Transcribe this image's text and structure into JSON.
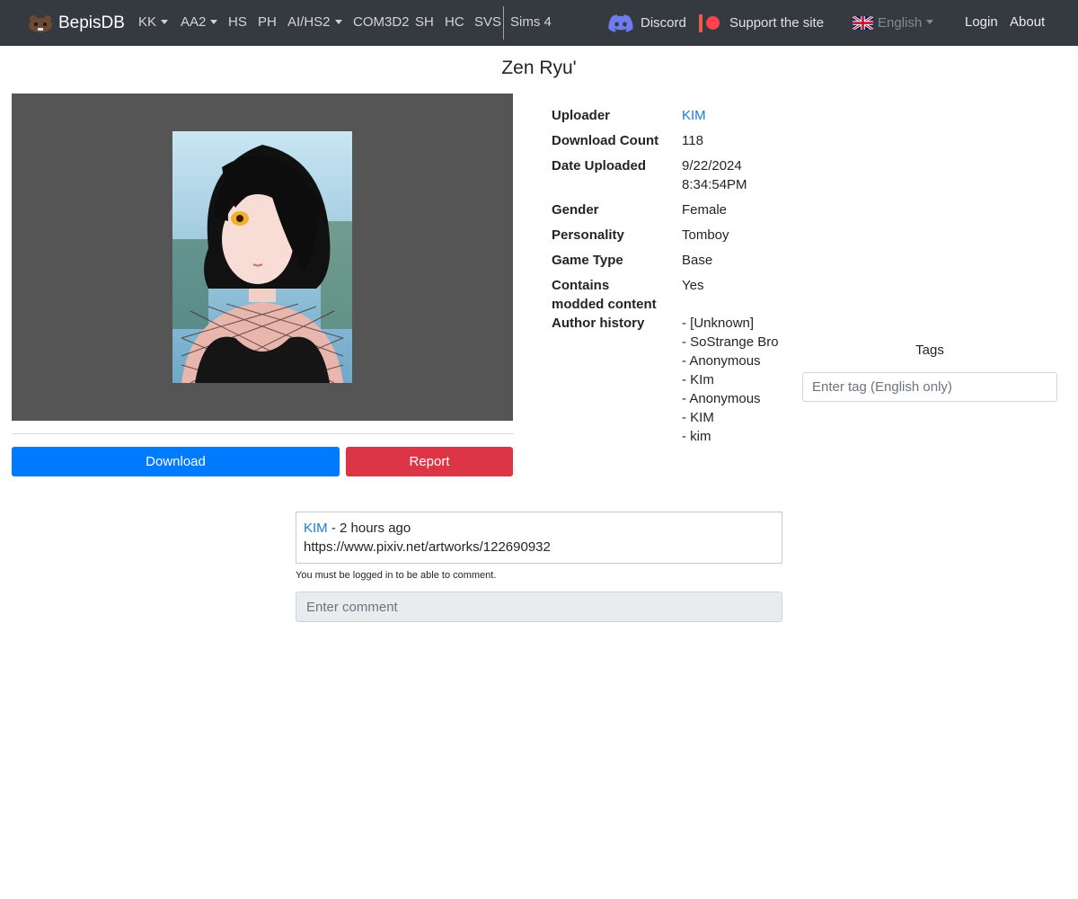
{
  "navbar": {
    "brand": "BepisDB",
    "items": [
      {
        "label": "KK",
        "dropdown": true
      },
      {
        "label": "AA2",
        "dropdown": true
      },
      {
        "label": "HS",
        "dropdown": false
      },
      {
        "label": "PH",
        "dropdown": false
      },
      {
        "label": "AI/HS2",
        "dropdown": true
      },
      {
        "label": "COM3D2",
        "dropdown": false
      },
      {
        "label": "SH",
        "dropdown": false
      },
      {
        "label": "HC",
        "dropdown": false
      },
      {
        "label": "SVS",
        "dropdown": false
      },
      {
        "label": "Sims 4",
        "dropdown": false
      }
    ],
    "discord": "Discord",
    "support": "Support the site",
    "language": "English",
    "login": "Login",
    "about": "About"
  },
  "card": {
    "title": "Zen Ryu'",
    "download_label": "Download",
    "report_label": "Report",
    "info": [
      {
        "label": "Uploader",
        "value": "KIM",
        "is_link": true
      },
      {
        "label": "Download Count",
        "value": "118"
      },
      {
        "label": "Date Uploaded",
        "value": "9/22/2024",
        "value2": "8:34:54PM"
      },
      {
        "label": "Gender",
        "value": "Female"
      },
      {
        "label": "Personality",
        "value": "Tomboy"
      },
      {
        "label": "Game Type",
        "value": "Base"
      },
      {
        "label": "Contains",
        "label2": "modded content",
        "value": "Yes"
      },
      {
        "label": "Author history"
      }
    ],
    "author_history": [
      "- [Unknown]",
      "- SoStrange Bro",
      "- Anonymous",
      "- KIm",
      "- Anonymous",
      "- KIM",
      "- kim"
    ]
  },
  "tags": {
    "title": "Tags",
    "placeholder": "Enter tag (English only)"
  },
  "comments": {
    "items": [
      {
        "author": "KIM",
        "time": " - 2 hours ago",
        "text": "https://www.pixiv.net/artworks/122690932"
      }
    ],
    "login_note": "You must be logged in to be able to comment.",
    "placeholder": "Enter comment"
  },
  "colors": {
    "navbar_bg": "#343a40",
    "link": "#1a7bd6",
    "download_button": "#007bff",
    "report_button": "#dc3545",
    "image_panel_bg": "#555555"
  }
}
